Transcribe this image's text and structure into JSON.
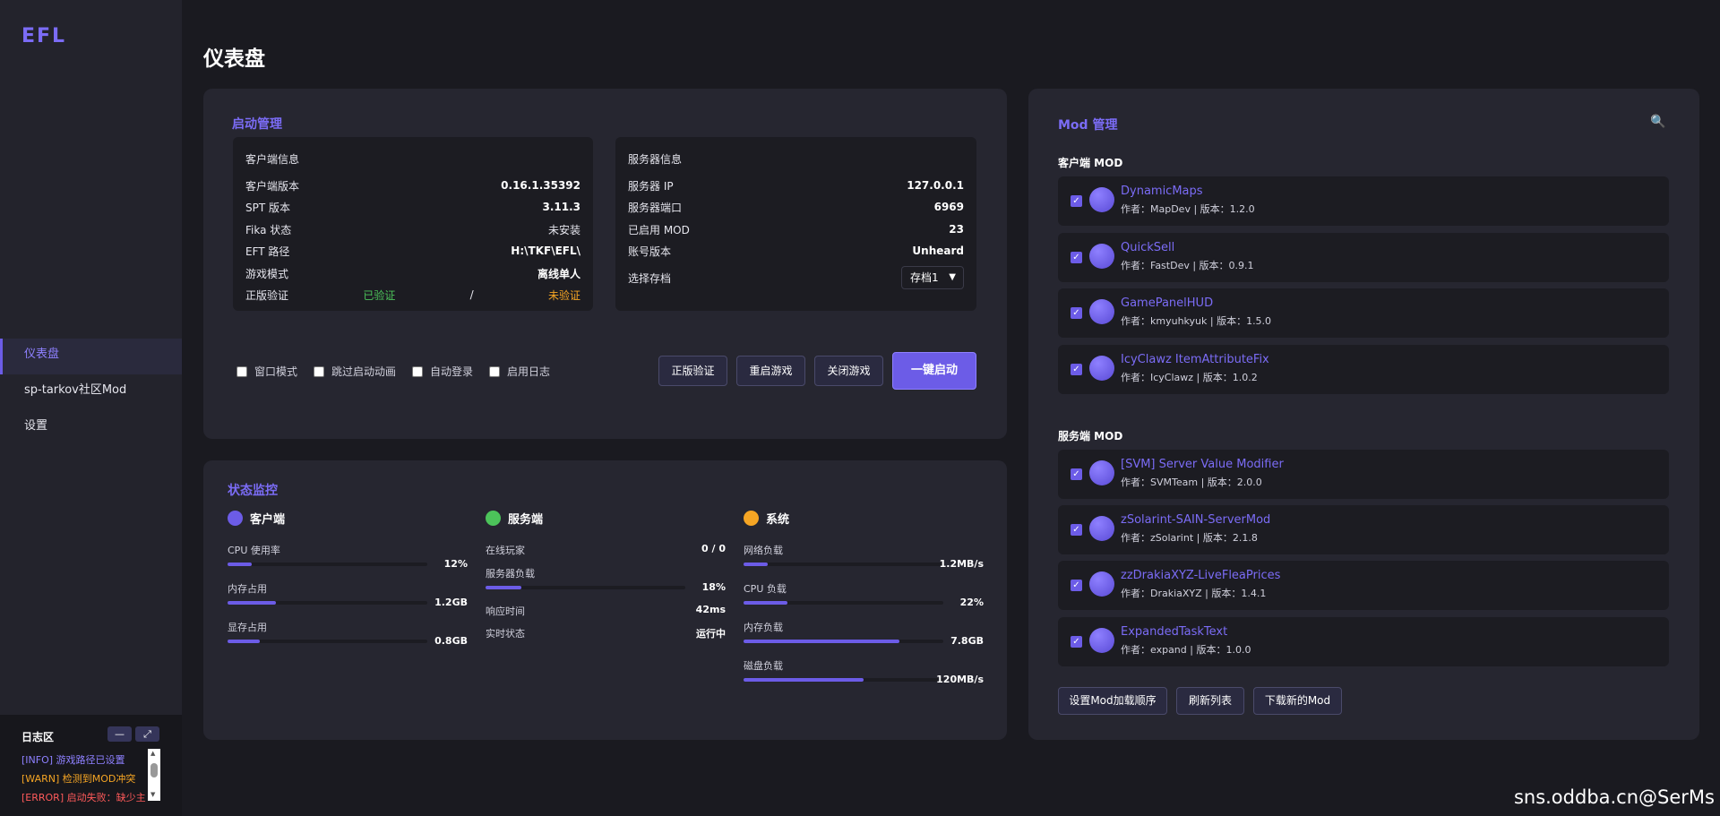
{
  "app": {
    "logo": "EFL"
  },
  "nav": [
    {
      "label": "仪表盘"
    },
    {
      "label": "sp-tarkov社区Mod"
    },
    {
      "label": "设置"
    }
  ],
  "log": {
    "title": "日志区",
    "minimize": "—",
    "expand": "⤢",
    "lines": [
      "[INFO] 游戏路径已设置",
      "[WARN] 检测到MOD冲突",
      "[ERROR] 启动失败：缺少主"
    ]
  },
  "page": {
    "title": "仪表盘"
  },
  "launch": {
    "title": "启动管理",
    "client": {
      "head": "客户端信息",
      "rows": [
        {
          "k": "客户端版本",
          "v": "0.16.1.35392"
        },
        {
          "k": "SPT 版本",
          "v": "3.11.3"
        },
        {
          "k": "Fika 状态",
          "v": "未安装"
        },
        {
          "k": "EFT 路径",
          "v": "H:\\TKF\\EFL\\"
        },
        {
          "k": "游戏模式",
          "v": "离线单人"
        }
      ],
      "verify_label": "正版验证",
      "verify_ok": "已验证",
      "verify_sep": "/",
      "verify_no": "未验证"
    },
    "server": {
      "head": "服务器信息",
      "rows": [
        {
          "k": "服务器 IP",
          "v": "127.0.0.1"
        },
        {
          "k": "服务器端口",
          "v": "6969"
        },
        {
          "k": "已启用 MOD",
          "v": "23"
        },
        {
          "k": "账号版本",
          "v": "Unheard"
        }
      ],
      "profile_label": "选择存档",
      "profile_value": "存档1"
    },
    "options": [
      "窗口模式",
      "跳过启动动画",
      "自动登录",
      "启用日志"
    ],
    "buttons": {
      "verify": "正版验证",
      "restart": "重启游戏",
      "close": "关闭游戏",
      "launch": "一键启动"
    }
  },
  "monitor": {
    "title": "状态监控",
    "accent": "#6c5ce7",
    "client": {
      "head": "客户端",
      "metrics": [
        {
          "label": "CPU 使用率",
          "value": "12%",
          "fill": 0.12
        },
        {
          "label": "内存占用",
          "value": "1.2GB",
          "fill": 0.24
        },
        {
          "label": "显存占用",
          "value": "0.8GB",
          "fill": 0.16
        }
      ]
    },
    "server": {
      "head": "服务端",
      "online_label": "在线玩家",
      "online_value": "0 / 0",
      "load_label": "服务器负载",
      "load_value": "18%",
      "load_fill": 0.18,
      "resp_label": "响应时间",
      "resp_value": "42ms",
      "status_label": "实时状态",
      "status_value": "运行中"
    },
    "system": {
      "head": "系统",
      "metrics": [
        {
          "label": "网络负载",
          "value": "1.2MB/s",
          "fill": 0.12
        },
        {
          "label": "CPU 负载",
          "value": "22%",
          "fill": 0.22
        },
        {
          "label": "内存负载",
          "value": "7.8GB",
          "fill": 0.78
        },
        {
          "label": "磁盘负载",
          "value": "120MB/s",
          "fill": 0.6
        }
      ]
    }
  },
  "mods": {
    "title": "Mod 管理",
    "client_head": "客户端 MOD",
    "server_head": "服务端 MOD",
    "client": [
      {
        "name": "DynamicMaps",
        "meta": "作者：MapDev | 版本：1.2.0"
      },
      {
        "name": "QuickSell",
        "meta": "作者：FastDev | 版本：0.9.1"
      },
      {
        "name": "GamePanelHUD",
        "meta": "作者：kmyuhkyuk | 版本：1.5.0"
      },
      {
        "name": "IcyClawz ItemAttributeFix",
        "meta": "作者：IcyClawz | 版本：1.0.2"
      }
    ],
    "server": [
      {
        "name": "[SVM] Server Value Modifier",
        "meta": "作者：SVMTeam | 版本：2.0.0"
      },
      {
        "name": "zSolarint-SAIN-ServerMod",
        "meta": "作者：zSolarint | 版本：2.1.8"
      },
      {
        "name": "zzDrakiaXYZ-LiveFleaPrices",
        "meta": "作者：DrakiaXYZ | 版本：1.4.1"
      },
      {
        "name": "ExpandedTaskText",
        "meta": "作者：expand | 版本：1.0.0"
      }
    ],
    "buttons": {
      "order": "设置Mod加载顺序",
      "refresh": "刷新列表",
      "download": "下载新的Mod"
    }
  },
  "watermark": "sns.oddba.cn@SerMs"
}
